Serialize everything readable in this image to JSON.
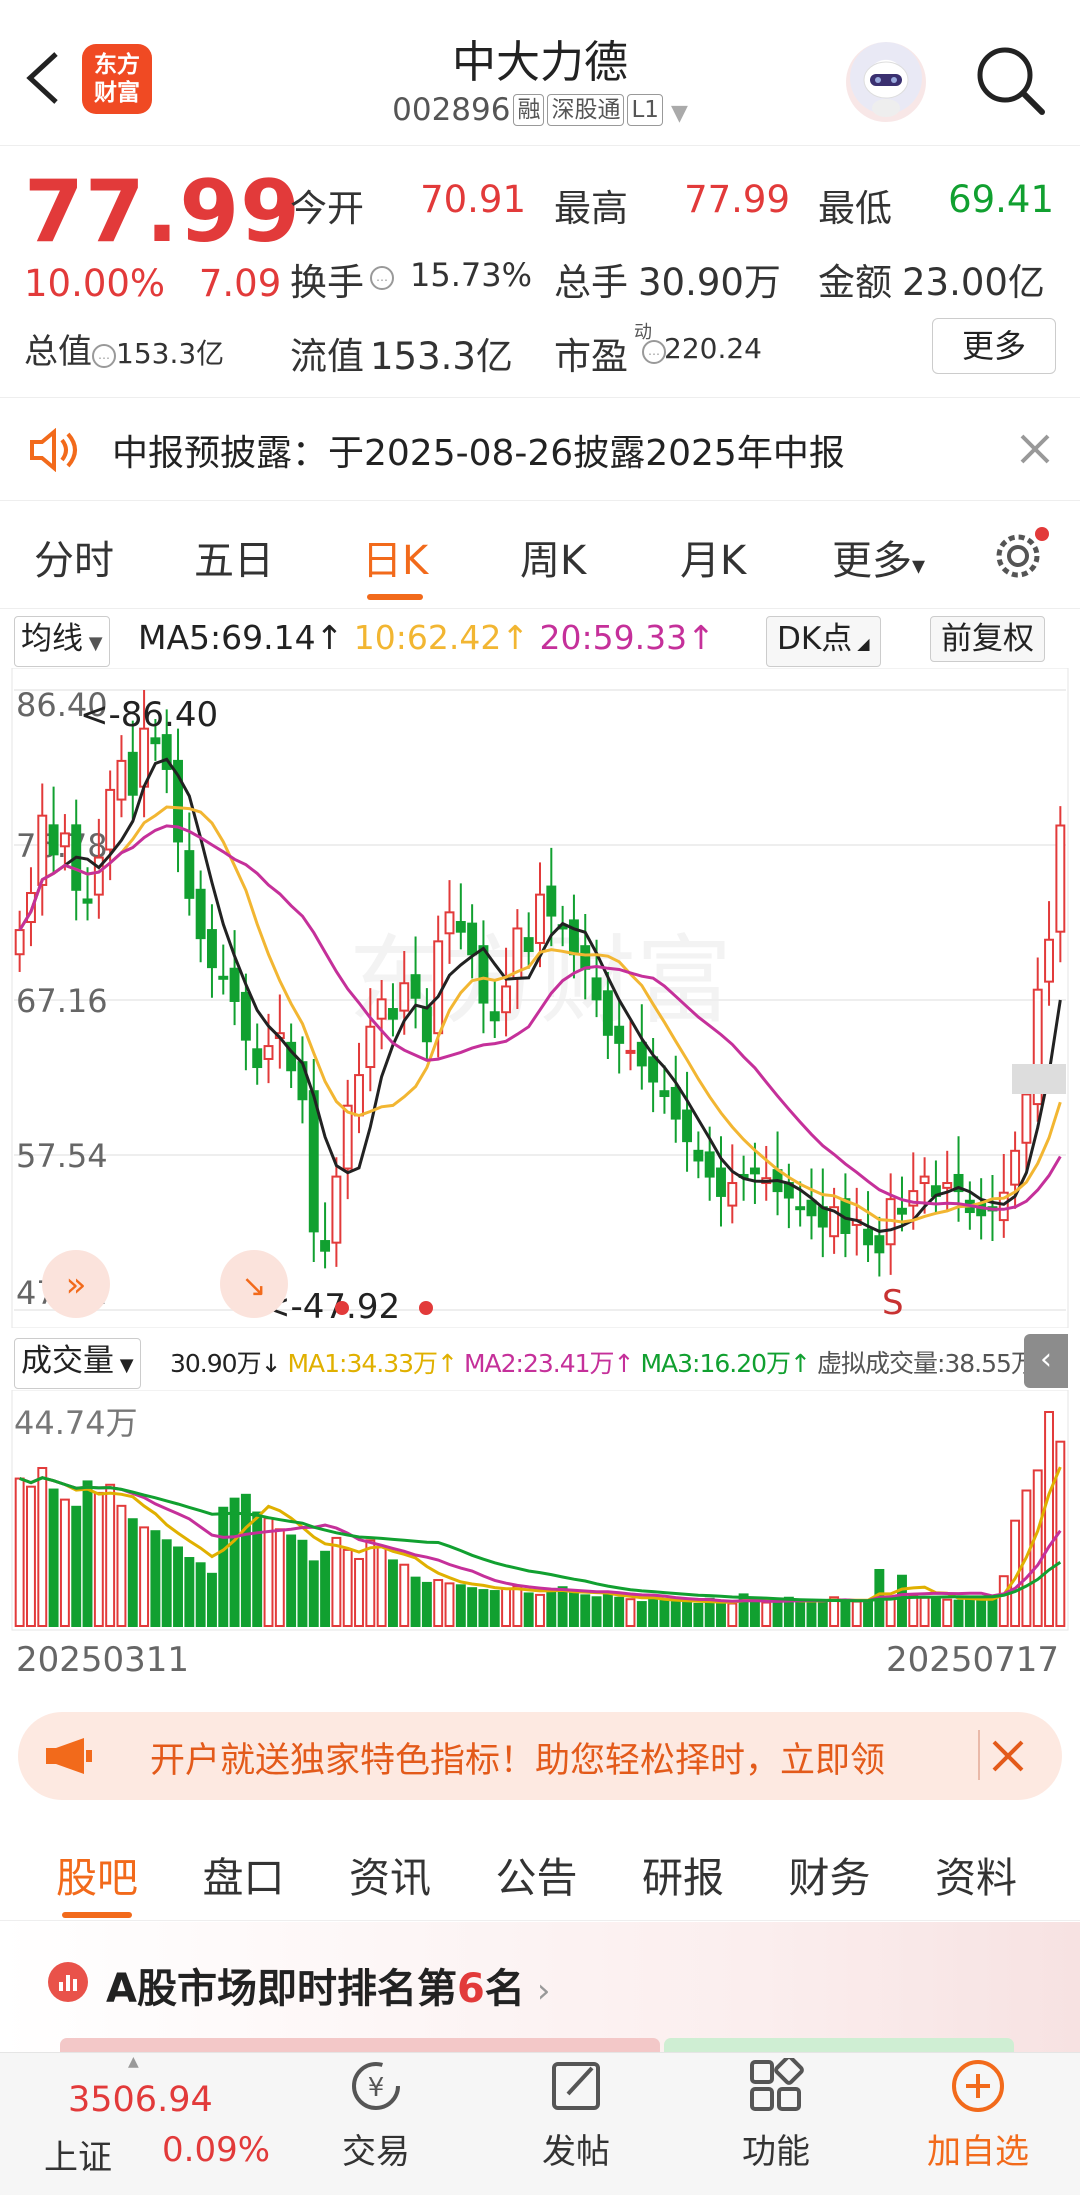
{
  "header": {
    "title": "中大力德",
    "code": "002896",
    "tags": [
      "融",
      "深股通",
      "L1"
    ],
    "logo_line1": "东方",
    "logo_line2": "财富"
  },
  "quote": {
    "price": "77.99",
    "change_pct": "10.00%",
    "change_abs": "7.09",
    "total_value_label": "总值",
    "total_value": "153.3亿",
    "rows": [
      [
        {
          "label": "今开",
          "value": "70.91",
          "color": "#e23a3a"
        },
        {
          "label": "最高",
          "value": "77.99",
          "color": "#e23a3a"
        },
        {
          "label": "最低",
          "value": "69.41",
          "color": "#11a030"
        }
      ],
      [
        {
          "label": "换手",
          "value": "15.73%",
          "color": "#333"
        },
        {
          "label": "总手",
          "value": "30.90万",
          "color": "#333"
        },
        {
          "label": "金额",
          "value": "23.00亿",
          "color": "#333"
        }
      ],
      [
        {
          "label": "流值",
          "value": "153.3亿",
          "color": "#333"
        },
        {
          "label": "市盈",
          "value": "220.24",
          "color": "#333"
        }
      ]
    ],
    "pe_sup": "动",
    "more_label": "更多"
  },
  "notice": {
    "text": "中报预披露：于2025-08-26披露2025年中报"
  },
  "kline_tabs": [
    {
      "label": "分时",
      "active": false
    },
    {
      "label": "五日",
      "active": false
    },
    {
      "label": "日K",
      "active": true
    },
    {
      "label": "周K",
      "active": false
    },
    {
      "label": "月K",
      "active": false
    },
    {
      "label": "更多",
      "active": false
    }
  ],
  "ma_legend": {
    "selector": "均线",
    "ma5": "MA5:69.14↑",
    "ma10": "10:62.42↑",
    "ma20": "20:59.33↑",
    "dk_label": "DK点",
    "adjust_label": "前复权"
  },
  "price_axis": [
    "86.40",
    "76.78",
    "67.16",
    "57.54",
    "47.92"
  ],
  "annotations": {
    "high": "<-86.40",
    "low": "<-47.92",
    "signal": "S"
  },
  "volume_legend": {
    "selector": "成交量",
    "vol": "30.90万↓",
    "ma1": "MA1:34.33万↑",
    "ma2": "MA2:23.41万↑",
    "ma3": "MA3:16.20万↑",
    "virtual": "虚拟成交量:38.55万"
  },
  "volume_axis_max": "44.74万",
  "date_range": {
    "start": "20250311",
    "end": "20250717"
  },
  "colors": {
    "up": "#e23a3a",
    "down": "#11a030",
    "ma5": "#222222",
    "ma10": "#f2b632",
    "ma20": "#c5309a",
    "accent": "#f26a1b"
  },
  "chart_data": {
    "type": "candlestick",
    "ylim": [
      47.92,
      86.4
    ],
    "close": [
      71.5,
      73.8,
      78.6,
      76.2,
      77.5,
      74.0,
      73.2,
      76.0,
      80.2,
      82.0,
      79.9,
      84.0,
      83.1,
      81.5,
      77.0,
      73.5,
      71.0,
      69.2,
      68.6,
      67.1,
      64.7,
      63.0,
      64.3,
      65.1,
      62.8,
      61.0,
      52.8,
      51.6,
      56.2,
      60.6,
      62.5,
      65.5,
      67.2,
      66.0,
      68.2,
      67.3,
      64.6,
      70.8,
      72.6,
      71.4,
      70.0,
      67.0,
      65.9,
      68.0,
      71.6,
      70.2,
      73.7,
      72.4,
      71.6,
      70.0,
      69.1,
      67.2,
      65.0,
      64.5,
      64.0,
      63.1,
      62.1,
      61.2,
      59.8,
      58.4,
      57.2,
      56.2,
      55.0,
      55.8,
      56.2,
      56.4,
      56.1,
      55.3,
      54.9,
      54.2,
      53.8,
      53.1,
      54.3,
      52.7,
      53.5,
      52.0,
      51.5,
      54.8,
      53.9,
      55.3,
      56.2,
      55.0,
      55.8,
      55.3,
      54.0,
      53.8,
      54.1,
      55.2,
      57.8,
      61.3,
      67.8,
      70.9,
      77.99
    ],
    "volume": [
      30.8,
      29.1,
      33.0,
      28.5,
      26.4,
      24.9,
      30.2,
      27.8,
      29.5,
      25.1,
      22.3,
      20.6,
      19.8,
      17.9,
      16.4,
      14.2,
      13.1,
      10.9,
      24.7,
      26.6,
      27.4,
      23.7,
      22.5,
      20.2,
      18.9,
      17.8,
      13.5,
      15.5,
      18.4,
      15.9,
      14.0,
      17.9,
      16.5,
      13.7,
      12.8,
      10.1,
      9.0,
      9.6,
      8.9,
      8.5,
      7.9,
      7.5,
      7.3,
      7.8,
      8.3,
      6.8,
      6.5,
      7.5,
      8.1,
      6.9,
      6.4,
      6.0,
      7.1,
      5.9,
      5.6,
      5.0,
      6.1,
      5.4,
      5.0,
      4.8,
      4.6,
      5.7,
      4.9,
      4.7,
      6.6,
      5.3,
      4.9,
      4.8,
      5.9,
      5.2,
      5.3,
      5.0,
      6.0,
      5.5,
      5.1,
      5.2,
      11.7,
      6.0,
      10.5,
      6.4,
      5.9,
      6.0,
      5.5,
      5.3,
      6.0,
      5.2,
      6.0,
      10.4,
      22.0,
      28.3,
      32.5,
      44.7,
      38.5
    ]
  },
  "promo": {
    "text": "开户就送独家特色指标！助您轻松择时，立即领"
  },
  "info_tabs": [
    {
      "label": "股吧",
      "active": true
    },
    {
      "label": "盘口",
      "active": false
    },
    {
      "label": "资讯",
      "active": false
    },
    {
      "label": "公告",
      "active": false
    },
    {
      "label": "研报",
      "active": false
    },
    {
      "label": "财务",
      "active": false
    },
    {
      "label": "资料",
      "active": false
    }
  ],
  "ranking": {
    "prefix": "A股市场即时排名第",
    "rank": "6",
    "suffix": "名"
  },
  "bottom_nav": {
    "index_value": "3506.94",
    "index_name": "上证",
    "index_change": "0.09%",
    "items": [
      {
        "label": "交易"
      },
      {
        "label": "发帖"
      },
      {
        "label": "功能"
      },
      {
        "label": "加自选",
        "accent": true
      }
    ]
  }
}
